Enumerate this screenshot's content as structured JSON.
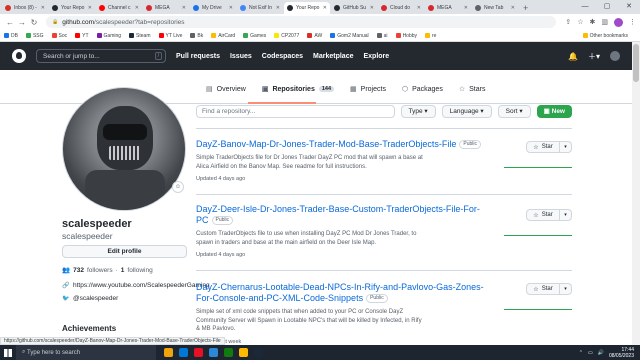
{
  "browser": {
    "tabs": [
      {
        "label": "Inbox (8) -",
        "color": "#d93025",
        "active": false
      },
      {
        "label": "Your Repo",
        "color": "#24292f",
        "active": false
      },
      {
        "label": "Channel c",
        "color": "#ff0000",
        "active": false
      },
      {
        "label": "MEGA",
        "color": "#d9272e",
        "active": false
      },
      {
        "label": "My Drive",
        "color": "#1a73e8",
        "active": false
      },
      {
        "label": "Not Exif In",
        "color": "#4285f4",
        "active": false
      },
      {
        "label": "Your Repo",
        "color": "#24292f",
        "active": true
      },
      {
        "label": "GitHub Su",
        "color": "#24292f",
        "active": false
      },
      {
        "label": "Cloud do",
        "color": "#d9272e",
        "active": false
      },
      {
        "label": "MEGA",
        "color": "#d9272e",
        "active": false
      },
      {
        "label": "New Tab",
        "color": "#5f6368",
        "active": false
      }
    ],
    "new_tab": "+",
    "window_controls": {
      "minimize": "—",
      "maximize": "▢",
      "close": "✕"
    },
    "url_host": "github.com",
    "url_path": "/scalespeeder?tab=repositories",
    "bookmarks": [
      {
        "label": "DB",
        "color": "#1a73e8"
      },
      {
        "label": "SSG",
        "color": "#34a853"
      },
      {
        "label": "Soc",
        "color": "#ea4335"
      },
      {
        "label": "YT",
        "color": "#ff0000"
      },
      {
        "label": "Gaming",
        "color": "#7b1fa2"
      },
      {
        "label": "Steam",
        "color": "#1b2838"
      },
      {
        "label": "YT Live",
        "color": "#ff0000"
      },
      {
        "label": "Bk",
        "color": "#5f6368"
      },
      {
        "label": "AirCard",
        "color": "#fbbc04"
      },
      {
        "label": "Games",
        "color": "#34a853"
      },
      {
        "label": "CP2077",
        "color": "#f9e900"
      },
      {
        "label": "AW",
        "color": "#d93025"
      },
      {
        "label": "Gom2 Manual",
        "color": "#1a73e8"
      },
      {
        "label": "ai",
        "color": "#5f6368"
      },
      {
        "label": "Hobby",
        "color": "#ea4335"
      },
      {
        "label": "re",
        "color": "#fbbc04"
      }
    ],
    "other_bookmarks": "Other bookmarks"
  },
  "github": {
    "search_placeholder": "Search or jump to...",
    "search_key": "/",
    "nav": [
      "Pull requests",
      "Issues",
      "Codespaces",
      "Marketplace",
      "Explore"
    ],
    "tabs": [
      {
        "label": "Overview",
        "icon": "▤",
        "count": null
      },
      {
        "label": "Repositories",
        "icon": "▣",
        "count": "144"
      },
      {
        "label": "Projects",
        "icon": "▦",
        "count": null
      },
      {
        "label": "Packages",
        "icon": "⬡",
        "count": null
      },
      {
        "label": "Stars",
        "icon": "☆",
        "count": null
      }
    ]
  },
  "profile": {
    "name": "scalespeeder",
    "username": "scalespeeder",
    "edit_button": "Edit profile",
    "followers_count": "732",
    "followers_label": "followers",
    "separator": "·",
    "following_count": "1",
    "following_label": "following",
    "website": "https://www.youtube.com/ScalespeederGaming",
    "twitter": "@scalespeeder",
    "achievements": "Achievements"
  },
  "filters": {
    "find_placeholder": "Find a repository...",
    "type": "Type ▾",
    "language": "Language ▾",
    "sort": "Sort ▾",
    "new": "New"
  },
  "repos": [
    {
      "title": "DayZ-Banov-Map-Dr-Jones-Trader-Mod-Base-TraderObjects-File",
      "visibility": "Public",
      "description": "Simple TraderObjects file for Dr Jones Trader DayZ PC mod that will spawn a base at Alica Airfield on the Banov Map. See readme for full instructions.",
      "updated": "Updated 4 days ago",
      "star": "Star"
    },
    {
      "title": "DayZ-Deer-Isle-Dr-Jones-Trader-Base-Custom-TraderObjects-File-For-PC",
      "visibility": "Public",
      "description": "Custom TraderObjects file to use when installing DayZ PC Mod Dr Jones Trader, to spawn in traders and base at the main airfield on the Deer Isle Map.",
      "updated": "Updated 4 days ago",
      "star": "Star"
    },
    {
      "title": "DayZ-Chernarus-Lootable-Dead-NPCs-In-Rify-and-Pavlovo-Gas-Zones-For-Console-and-PC-XML-Code-Snippets",
      "visibility": "Public",
      "description": "Simple set of xml code snippets that when added to your PC or Console DayZ Community Server will Spawn in Lootable NPC's that will be killed by Infected, in Rify & MB Pavlovo.",
      "updated": "Updated last week",
      "star": "Star"
    }
  ],
  "status_url": "https://github.com/scalespeeder/DayZ-Banov-Map-Dr-Jones-Trader-Mod-Base-TraderObjects-File",
  "taskbar": {
    "search": "Type here to search",
    "apps": [
      "#f0a30a",
      "#0078d7",
      "#e81123",
      "#2b88d8",
      "#107c10",
      "#ffb900",
      "#1b2838"
    ],
    "time": "17:44",
    "date": "08/05/2023"
  }
}
